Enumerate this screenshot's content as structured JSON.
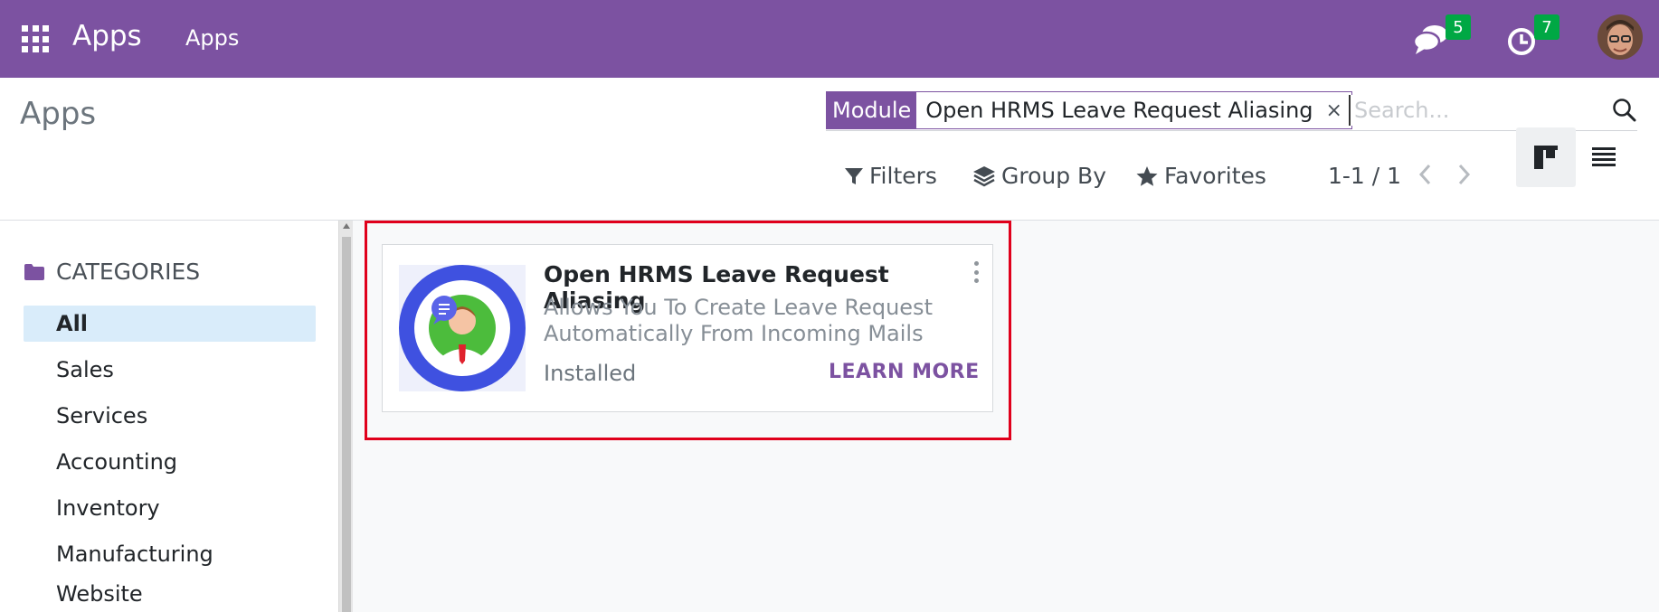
{
  "navbar": {
    "brand": "Apps",
    "menu_item": "Apps",
    "messages_count": "5",
    "activities_count": "7"
  },
  "control_panel": {
    "title": "Apps",
    "search": {
      "facet_label": "Module",
      "facet_value": "Open HRMS Leave Request Aliasing",
      "facet_close": "×",
      "placeholder": "Search..."
    },
    "filters_label": "Filters",
    "group_by_label": "Group By",
    "favorites_label": "Favorites",
    "pager": "1-1 / 1"
  },
  "sidebar": {
    "heading": "CATEGORIES",
    "items": [
      {
        "label": "All",
        "active": true
      },
      {
        "label": "Sales"
      },
      {
        "label": "Services"
      },
      {
        "label": "Accounting"
      },
      {
        "label": "Inventory"
      },
      {
        "label": "Manufacturing"
      },
      {
        "label": "Website"
      }
    ]
  },
  "card": {
    "title": "Open HRMS Leave Request Aliasing",
    "summary": "Allows You To Create Leave Request Automatically From Incoming Mails",
    "status": "Installed",
    "learn_more": "LEARN MORE"
  },
  "colors": {
    "brand": "#7c52a1",
    "badge": "#00a844",
    "highlight": "#e0001b",
    "active_category": "#d9ecfa"
  },
  "icons": [
    "apps-grid-icon",
    "chat-icon",
    "clock-icon",
    "search-icon",
    "filter-icon",
    "layers-icon",
    "star-icon",
    "chevron-left-icon",
    "chevron-right-icon",
    "kanban-view-icon",
    "list-view-icon",
    "folder-icon",
    "kebab-menu-icon"
  ]
}
